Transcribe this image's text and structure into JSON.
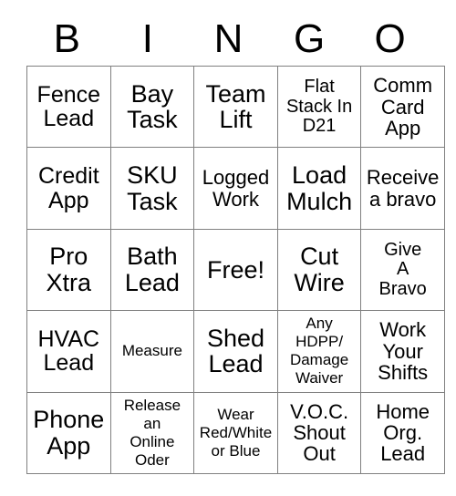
{
  "card": {
    "title": "BINGO",
    "header_letters": [
      "B",
      "I",
      "N",
      "G",
      "O"
    ],
    "free_space_label": "Free!",
    "colors": {
      "text": "#000000",
      "grid_line": "#808080",
      "background": "#ffffff"
    },
    "rows": [
      [
        {
          "text": "Fence\nLead",
          "size": "lg"
        },
        {
          "text": "Bay\nTask",
          "size": "xl"
        },
        {
          "text": "Team\nLift",
          "size": "xl"
        },
        {
          "text": "Flat\nStack In\nD21",
          "size": "sm"
        },
        {
          "text": "Comm\nCard\nApp",
          "size": "md"
        }
      ],
      [
        {
          "text": "Credit\nApp",
          "size": "lg"
        },
        {
          "text": "SKU\nTask",
          "size": "xl"
        },
        {
          "text": "Logged\nWork",
          "size": "md"
        },
        {
          "text": "Load\nMulch",
          "size": "xl"
        },
        {
          "text": "Receive\na bravo",
          "size": "md"
        }
      ],
      [
        {
          "text": "Pro\nXtra",
          "size": "xl"
        },
        {
          "text": "Bath\nLead",
          "size": "xl"
        },
        {
          "text": "Free!",
          "size": "xl"
        },
        {
          "text": "Cut\nWire",
          "size": "xl"
        },
        {
          "text": "Give\nA\nBravo",
          "size": "sm"
        }
      ],
      [
        {
          "text": "HVAC\nLead",
          "size": "lg"
        },
        {
          "text": "Measure",
          "size": "xs"
        },
        {
          "text": "Shed\nLead",
          "size": "xl"
        },
        {
          "text": "Any\nHDPP/\nDamage\nWaiver",
          "size": "xs"
        },
        {
          "text": "Work\nYour\nShifts",
          "size": "md"
        }
      ],
      [
        {
          "text": "Phone\nApp",
          "size": "xl"
        },
        {
          "text": "Release\nan\nOnline\nOder",
          "size": "xs"
        },
        {
          "text": "Wear\nRed/White\nor Blue",
          "size": "xs"
        },
        {
          "text": "V.O.C.\nShout\nOut",
          "size": "md"
        },
        {
          "text": "Home\nOrg.\nLead",
          "size": "md"
        }
      ]
    ]
  }
}
